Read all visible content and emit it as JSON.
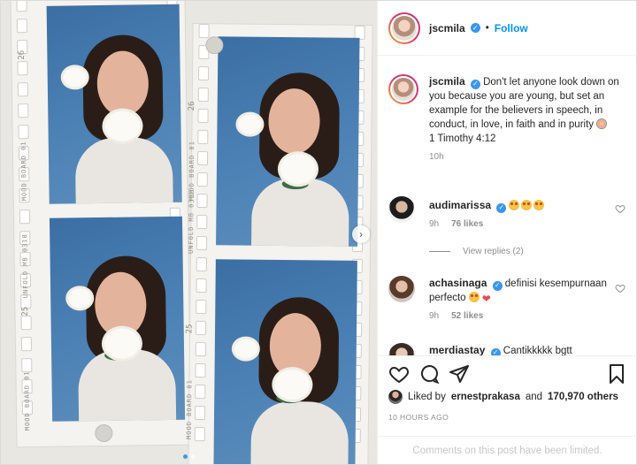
{
  "post": {
    "username": "jscmila",
    "follow_label": "Follow",
    "separator": "•",
    "caption": "Don't let anyone look down on you because you are young, but set an example for the believers in speech, in conduct, in love, in faith and in purity",
    "caption_reference": "1 Timothy 4:12",
    "caption_time": "10h",
    "film_stamps": [
      "MOOD BOARD 01",
      "UNFOLD MB 0318",
      "MOOD BOARD 01",
      "UNFOLD MB 0318",
      "MOOD BOARD 01",
      "MOOD BOARD 01"
    ],
    "film_numbers": [
      "26",
      "26",
      "25",
      "25"
    ]
  },
  "comments": [
    {
      "username": "audimarissa",
      "text": "",
      "emojis": [
        "star-struck-emoji",
        "star-struck-emoji",
        "star-struck-emoji"
      ],
      "time": "9h",
      "likes": "76 likes",
      "view_replies": "View replies (2)"
    },
    {
      "username": "achasinaga",
      "text": "definisi kesempurnaan perfecto",
      "emojis": [
        "star-struck-emoji",
        "red-heart-emoji"
      ],
      "time": "9h",
      "likes": "52 likes"
    },
    {
      "username": "merdiastay",
      "text": "Cantikkkkk bgtt"
    }
  ],
  "actions": {
    "liked_by_prefix": "Liked by",
    "liked_by_user": "ernestprakasa",
    "and": "and",
    "others": "170,970 others",
    "posted_ago": "10 HOURS AGO",
    "comments_limited": "Comments on this post have been limited."
  },
  "colors": {
    "accent": "#0095f6",
    "verified": "#3897f0",
    "muted": "#8e8e8e",
    "photo_background": "#4d82b6"
  }
}
